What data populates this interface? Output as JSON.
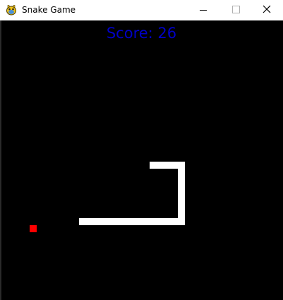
{
  "window": {
    "title": "Snake Game",
    "app_icon": "pygame-snake-icon",
    "controls": {
      "minimize": "minimize-icon",
      "maximize": "maximize-icon",
      "close": "close-icon"
    }
  },
  "game": {
    "score_text": "Score: 26",
    "score": 26,
    "snake_color": "#ffffff",
    "food_color": "#ff0000",
    "score_color": "#0000c8",
    "background": "#000000"
  }
}
